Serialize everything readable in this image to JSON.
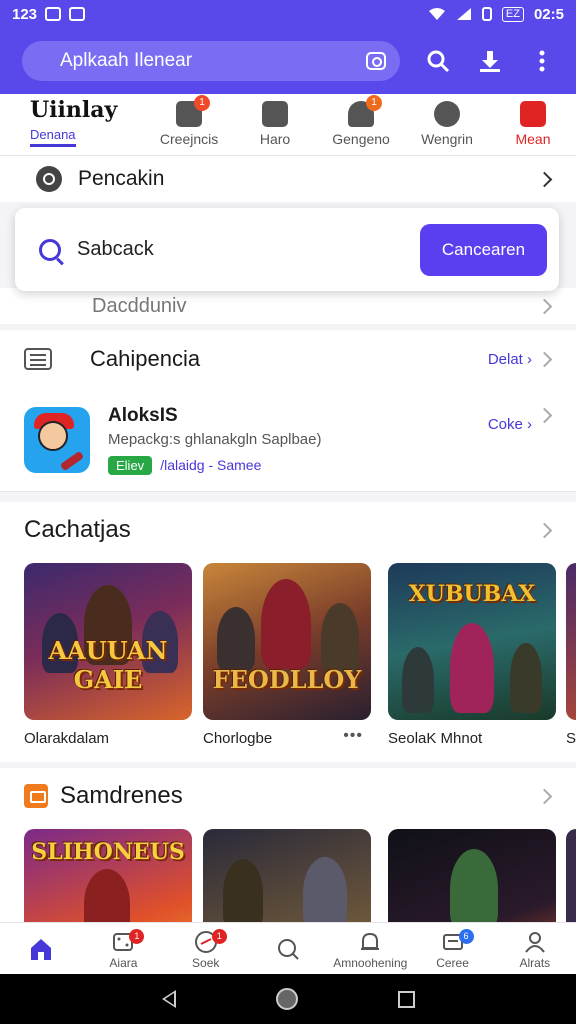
{
  "status_bar": {
    "time": "123",
    "battery": "EZ",
    "clock": "02:5"
  },
  "search": {
    "value": "Aplkaah Ilenear"
  },
  "tabs": [
    {
      "label": "Uiinlay",
      "sublabel": "Denana"
    },
    {
      "label": "Creejncis",
      "badge": "1"
    },
    {
      "label": "Haro"
    },
    {
      "label": "Gengeno",
      "badge": "1"
    },
    {
      "label": "Wengrin"
    },
    {
      "label": "Mean"
    }
  ],
  "rows": {
    "pencakin": "Pencakin",
    "hidden_row": "Dacdduniv",
    "cahipencia": {
      "title": "Cahipencia",
      "link": "Delat ›"
    }
  },
  "search_card": {
    "text": "Sabcack",
    "button": "Cancearen"
  },
  "featured_app": {
    "name": "AloksIS",
    "description": "Mepackg:s ghlanakgln Saplbae)",
    "tag": "Eliev",
    "category": "/lalaidg - Samee",
    "link": "Coke ›"
  },
  "section1": {
    "title": "Cachatjas",
    "cards": [
      {
        "title": "Olarakdalam",
        "logo": "AAUUAN GAIE"
      },
      {
        "title": "Chorlogbe",
        "logo": "FEODLLOY"
      },
      {
        "title": "SeolaK Mhnot",
        "logo": "XUBUBAX"
      },
      {
        "title": "S",
        "logo": ""
      }
    ]
  },
  "section2": {
    "title": "Samdrenes",
    "cards": [
      {
        "logo": "SLIHONEUS"
      },
      {
        "logo": ""
      },
      {
        "logo": ""
      }
    ]
  },
  "bottom_nav": [
    {
      "label": "",
      "icon": "home-icon",
      "active": true
    },
    {
      "label": "Aiara",
      "icon": "dice-icon",
      "badge": "1"
    },
    {
      "label": "Soek",
      "icon": "game-icon",
      "badge": "1"
    },
    {
      "label": "",
      "icon": "search-icon"
    },
    {
      "label": "Amnoohening",
      "icon": "bell-icon"
    },
    {
      "label": "Ceree",
      "icon": "inbox-icon",
      "badge": "6"
    },
    {
      "label": "Alrats",
      "icon": "profile-icon"
    }
  ],
  "colors": {
    "brand": "#5a49ea",
    "accent": "#4638d8",
    "button": "#5a3ff0"
  }
}
